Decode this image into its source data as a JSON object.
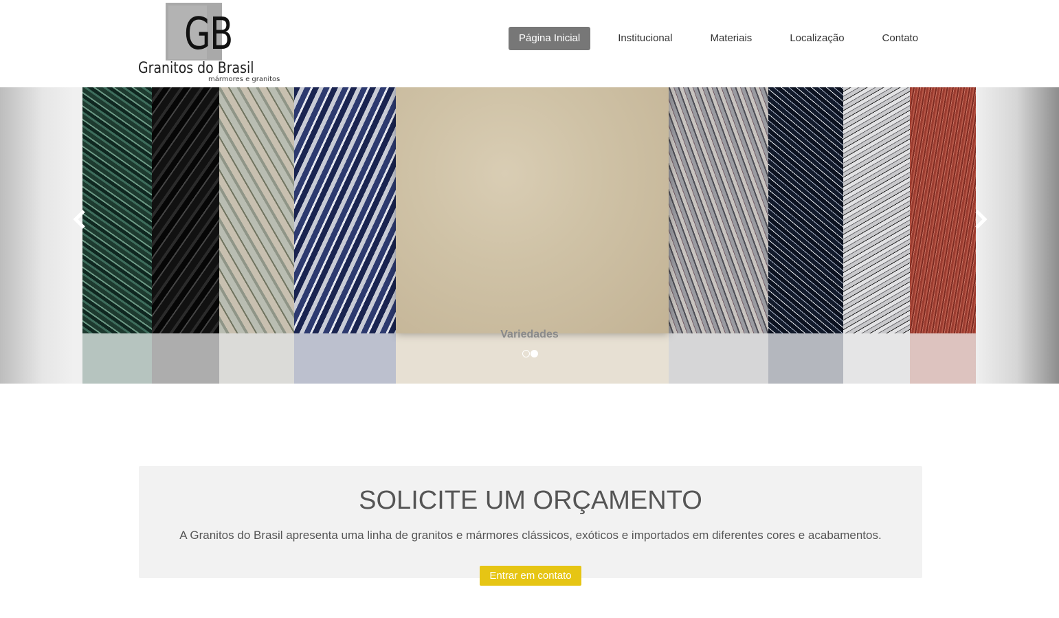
{
  "logo": {
    "monogram": "GB",
    "name": "Granitos do Brasil",
    "tagline": "mármores e granitos"
  },
  "nav": {
    "items": [
      {
        "label": "Página Inicial",
        "active": true
      },
      {
        "label": "Institucional",
        "active": false
      },
      {
        "label": "Materiais",
        "active": false
      },
      {
        "label": "Localização",
        "active": false
      },
      {
        "label": "Contato",
        "active": false
      }
    ]
  },
  "slider": {
    "caption": "Variedades",
    "slide_count": 2,
    "active_slide": 2,
    "prev_icon": "chevron-left-icon",
    "next_icon": "chevron-right-icon"
  },
  "cta": {
    "title": "SOLICITE UM ORÇAMENTO",
    "text": "A Granitos do Brasil apresenta uma linha de granitos e mármores clássicos, exóticos e importados em diferentes cores e acabamentos.",
    "button_label": "Entrar em contato"
  },
  "colors": {
    "nav_active_bg": "#777777",
    "cta_bg": "#f2f2f2",
    "cta_button": "#e6c514"
  }
}
